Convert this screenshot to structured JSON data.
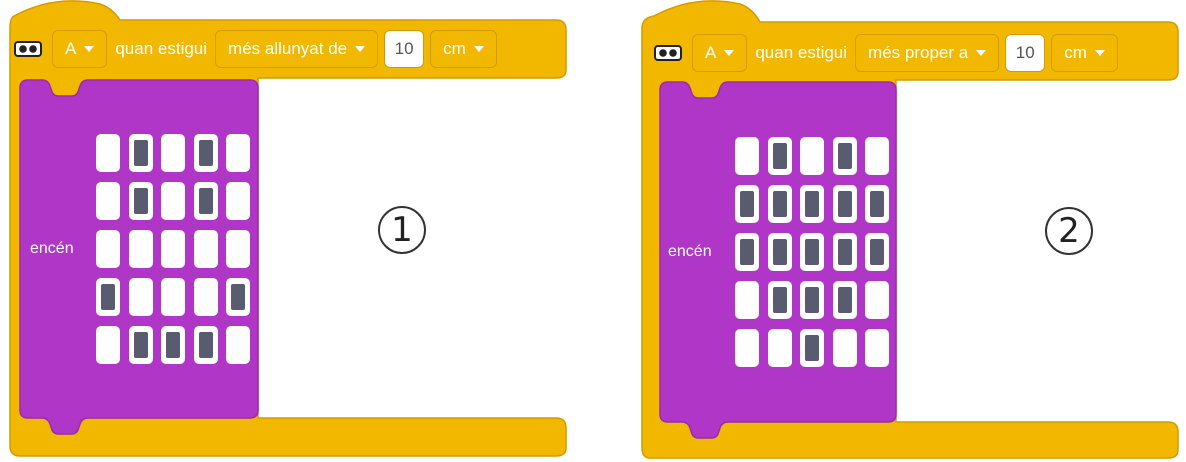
{
  "colors": {
    "event_block": "#f2b800",
    "led_block": "#b036c8",
    "led_on": "#595b6e"
  },
  "blocks": [
    {
      "icon": "distance-sensor-icon",
      "port": "A",
      "when_label": "quan estigui",
      "comparison": "més allunyat de",
      "value": "10",
      "unit": "cm",
      "action": "encén",
      "matrix": [
        [
          0,
          1,
          0,
          1,
          0
        ],
        [
          0,
          1,
          0,
          1,
          0
        ],
        [
          0,
          0,
          0,
          0,
          0
        ],
        [
          1,
          0,
          0,
          0,
          1
        ],
        [
          0,
          1,
          1,
          1,
          0
        ]
      ],
      "badge": "1"
    },
    {
      "icon": "distance-sensor-icon",
      "port": "A",
      "when_label": "quan estigui",
      "comparison": "més proper a",
      "value": "10",
      "unit": "cm",
      "action": "encén",
      "matrix": [
        [
          0,
          1,
          0,
          1,
          0
        ],
        [
          1,
          1,
          1,
          1,
          1
        ],
        [
          1,
          1,
          1,
          1,
          1
        ],
        [
          0,
          1,
          1,
          1,
          0
        ],
        [
          0,
          0,
          1,
          0,
          0
        ]
      ],
      "badge": "2"
    }
  ]
}
